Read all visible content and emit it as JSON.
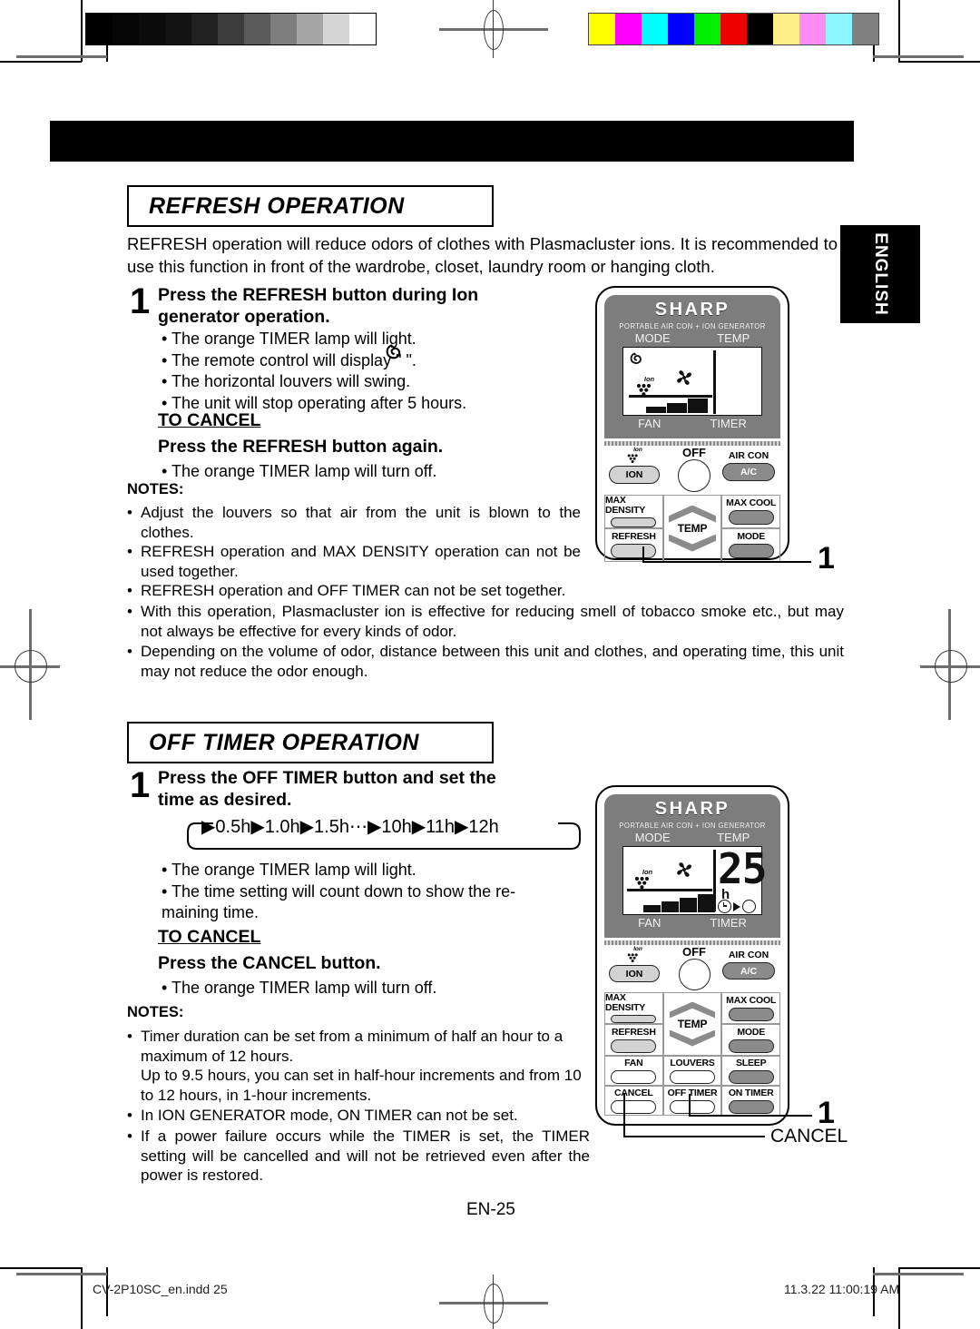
{
  "document": {
    "page_label": "EN-25",
    "language_tab": "ENGLISH",
    "footer_left": "CV-2P10SC_en.indd   25",
    "footer_right": "11.3.22   11:00:19 AM"
  },
  "printer_marks": {
    "grey_scale_bar": [
      "#000000",
      "#050505",
      "#0b0b0b",
      "#131313",
      "#222222",
      "#3c3c3c",
      "#5a5a5a",
      "#7e7e7e",
      "#a6a6a6",
      "#d4d4d4",
      "#ffffff"
    ],
    "color_bar": [
      "#ffff00",
      "#ff00ff",
      "#00ffff",
      "#0000ff",
      "#00ee00",
      "#ee0000",
      "#000000",
      "#ffef87",
      "#ff8cf5",
      "#8cf5ff",
      "#808080"
    ]
  },
  "sections": [
    {
      "id": "refresh",
      "heading": "REFRESH OPERATION",
      "intro": "REFRESH operation will reduce odors of clothes with Plasmacluster ions. It is recommended to use this function in front of the wardrobe, closet, laundry room or hanging cloth.",
      "step_number": "1",
      "step_title_line1": "Press the REFRESH button during Ion",
      "step_title_line2": "generator operation.",
      "bullets": [
        "• The orange TIMER lamp will light.",
        "• The remote control will display \"        \".",
        "• The horizontal louvers will swing.",
        "• The unit will stop operating after 5 hours."
      ],
      "to_cancel_label": "TO CANCEL",
      "to_cancel_action": "Press the REFRESH button again.",
      "to_cancel_bullet": "• The orange TIMER lamp will turn off.",
      "notes_title": "NOTES:",
      "notes": [
        "Adjust the louvers so that air from the unit is blown to the clothes.",
        "REFRESH operation and MAX DENSITY operation can not be used together.",
        "REFRESH operation and OFF TIMER can not be set together.",
        "With this operation, Plasmacluster ion is effective for reducing smell of tobacco smoke etc., but may not always be effective for every kinds of odor.",
        "Depending on the volume of odor, distance between this unit and clothes, and operating time, this unit may not reduce the odor enough."
      ],
      "callout_number": "1"
    },
    {
      "id": "offtimer",
      "heading": "OFF TIMER OPERATION",
      "step_number": "1",
      "step_title_line1": "Press  the  OFF  TIMER  button  and  set  the",
      "step_title_line2": "time as desired.",
      "sequence": [
        "0.5h",
        "1.0h",
        "1.5h",
        "10h",
        "11h",
        "12h"
      ],
      "sequence_ellipsis": "⋯",
      "bullets": [
        "• The orange TIMER lamp will light.",
        "• The  time  setting  will  count  down  to  show  the  re-",
        "   maining time."
      ],
      "to_cancel_label": "TO CANCEL ",
      "to_cancel_action": "Press the CANCEL button.",
      "to_cancel_bullet": "• The orange TIMER lamp will turn off.",
      "notes_title": "NOTES:",
      "notes": [
        "Timer duration can be set from a minimum of half an hour to a maximum of 12 hours.",
        "Up to 9.5 hours, you can set in half-hour increments and from 10 to 12 hours, in 1-hour increments.",
        "In ION GENERATOR mode, ON TIMER can not be set.",
        "If a power failure occurs while the TIMER is set, the TIMER setting will be cancelled and will not be retrieved even after the power is restored."
      ],
      "callout_number": "1",
      "callout_label": "CANCEL"
    }
  ],
  "remote_top": {
    "brand": "SHARP",
    "subtitle": "PORTABLE AIR CON + ION GENERATOR",
    "label_mode": "MODE",
    "label_temp": "TEMP",
    "label_fan": "FAN",
    "label_timer": "TIMER",
    "lcd": {
      "refresh_symbol": "refresh-swirl",
      "fan_symbol": "fan",
      "ion_symbol": "ion-grapes",
      "ion_text": "Ion",
      "temp_value": "",
      "fan_bars": 3
    },
    "buttons": {
      "ion_top": "Ion",
      "ion": "ION",
      "off": "OFF",
      "aircon_top": "AIR CON",
      "aircon": "A/C",
      "max_density": "MAX DENSITY",
      "max_cool": "MAX COOL",
      "temp": "TEMP",
      "refresh": "REFRESH",
      "mode": "MODE"
    }
  },
  "remote_bottom": {
    "brand": "SHARP",
    "subtitle": "PORTABLE AIR CON + ION GENERATOR",
    "label_mode": "MODE",
    "label_temp": "TEMP",
    "label_fan": "FAN",
    "label_timer": "TIMER",
    "lcd": {
      "fan_symbol": "fan",
      "ion_symbol": "ion-grapes",
      "ion_text": "Ion",
      "temp_value": "25",
      "unit": "h",
      "fan_bars": 4,
      "timer_indicator": "clock-arrow-circle"
    },
    "buttons": {
      "ion_top": "Ion",
      "ion": "ION",
      "off": "OFF",
      "aircon_top": "AIR CON",
      "aircon": "A/C",
      "max_density": "MAX DENSITY",
      "max_cool": "MAX COOL",
      "temp": "TEMP",
      "refresh": "REFRESH",
      "mode": "MODE",
      "fan": "FAN",
      "louvers": "LOUVERS",
      "sleep": "SLEEP",
      "cancel": "CANCEL",
      "off_timer": "OFF TIMER",
      "on_timer": "ON TIMER"
    }
  }
}
